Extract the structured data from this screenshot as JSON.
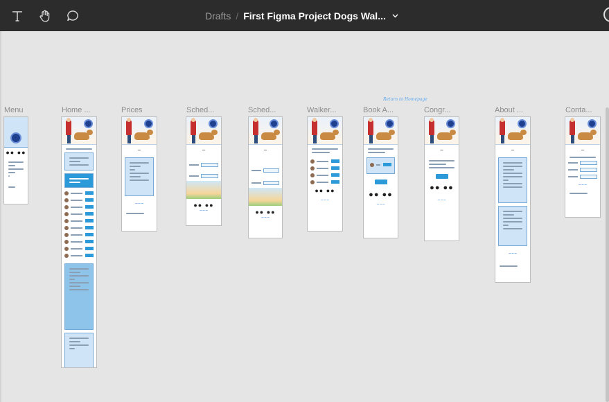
{
  "toolbar": {
    "icons": [
      "text-tool-icon",
      "hand-tool-icon",
      "comment-tool-icon"
    ],
    "breadcrumb_drafts": "Drafts",
    "breadcrumb_separator": "/",
    "file_name": "First Figma Project Dogs Wal...",
    "menu_icon": "chevron-down-icon"
  },
  "canvas": {
    "flow_connection_label": "Return to Homepage",
    "frames": [
      {
        "label": "Menu"
      },
      {
        "label": "Home ..."
      },
      {
        "label": "Prices"
      },
      {
        "label": "Sched..."
      },
      {
        "label": "Sched..."
      },
      {
        "label": "Walker..."
      },
      {
        "label": "Book A..."
      },
      {
        "label": "Congr..."
      },
      {
        "label": "About ..."
      },
      {
        "label": "Conta..."
      }
    ]
  },
  "colors": {
    "toolbar_bg": "#2c2c2c",
    "canvas_bg": "#e5e5e5",
    "accent_blue": "#2c9ad8",
    "brand_text": "#2f7fd1"
  }
}
